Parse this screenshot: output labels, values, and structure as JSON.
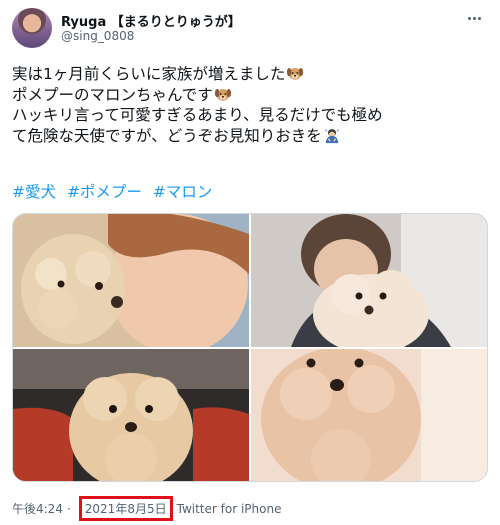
{
  "user": {
    "display_name": "Ryuga 【まるりとりゅうが】",
    "handle": "@sing_0808"
  },
  "tweet": {
    "lines": [
      "実は1ヶ月前くらいに家族が増えました",
      "ポメプーのマロンちゃんです",
      "ハッキリ言って可愛すぎるあまり、見るだけでも極め",
      "て危険な天使ですが、どうぞお見知りおきを"
    ],
    "emojis": [
      "dog-face-icon",
      "dog-face-icon",
      "bowing-person-icon"
    ],
    "hashtags": [
      "#愛犬",
      "#ポメプー",
      "#マロン"
    ]
  },
  "photos": [
    {
      "name": "photo-1",
      "alt": "person kissing poodle"
    },
    {
      "name": "photo-2",
      "alt": "person holding poodle"
    },
    {
      "name": "photo-3",
      "alt": "poodle on red sofa"
    },
    {
      "name": "photo-4",
      "alt": "poodle close-up"
    }
  ],
  "footer": {
    "time": "午後4:24",
    "date": "2021年8月5日",
    "source": "Twitter for iPhone"
  },
  "colors": {
    "link": "#1d9bf0",
    "highlight": "#e0101a",
    "secondary_text": "#536471"
  }
}
